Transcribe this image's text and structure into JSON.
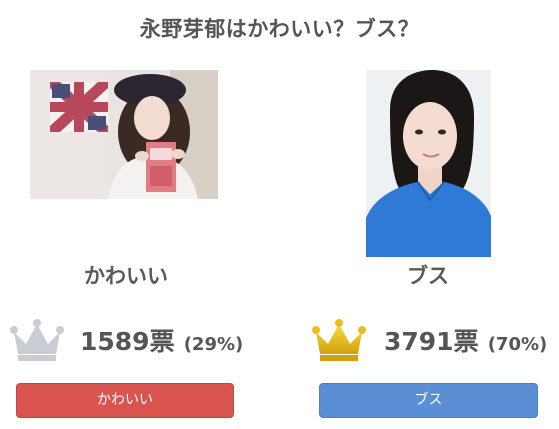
{
  "title": "永野芽郁はかわいい？ブス？",
  "options": [
    {
      "label": "かわいい",
      "votes": "1589票",
      "percent": "(29%)",
      "rank": "second",
      "crown_color": "#c9cdd3",
      "button_label": "かわいい",
      "button_color": "#d9534f",
      "photo_icon": "woman-beret-photo"
    },
    {
      "label": "ブス",
      "votes": "3791票",
      "percent": "(70%)",
      "rank": "first",
      "crown_color": "#e8c020",
      "button_label": "ブス",
      "button_color": "#5a8fd6",
      "photo_icon": "woman-blue-shirt-photo"
    }
  ]
}
